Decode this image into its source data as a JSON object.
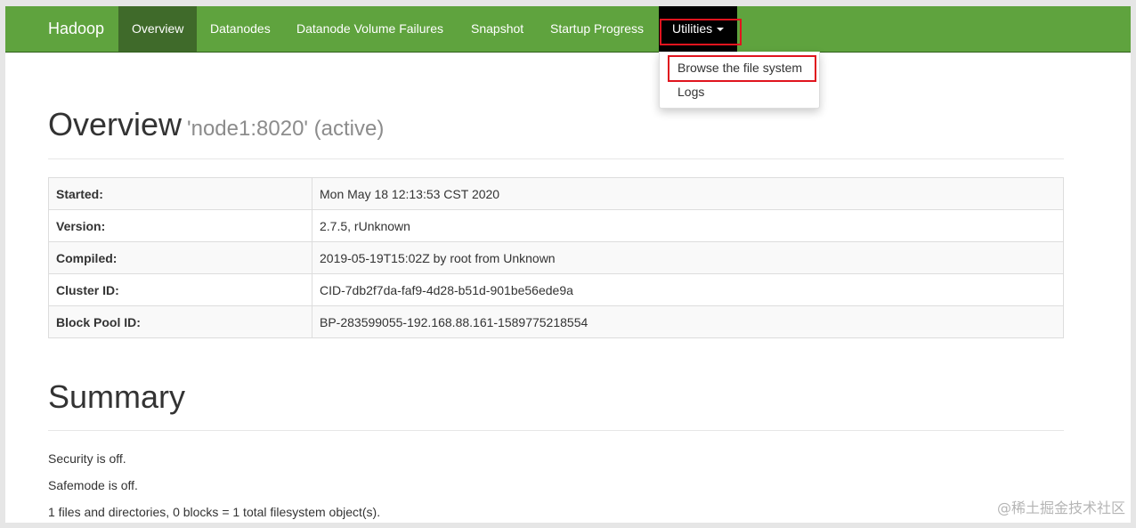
{
  "navbar": {
    "brand": "Hadoop",
    "items": [
      {
        "label": "Overview"
      },
      {
        "label": "Datanodes"
      },
      {
        "label": "Datanode Volume Failures"
      },
      {
        "label": "Snapshot"
      },
      {
        "label": "Startup Progress"
      },
      {
        "label": "Utilities"
      }
    ],
    "colors": {
      "bar": "#5fa33e",
      "active": "#3f6a2a",
      "open": "#000000",
      "highlight": "#e0141e"
    }
  },
  "dropdown": {
    "items": [
      {
        "label": "Browse the file system"
      },
      {
        "label": "Logs"
      }
    ]
  },
  "overview": {
    "title": "Overview",
    "subtitle": "'node1:8020' (active)",
    "rows": [
      {
        "key": "Started:",
        "value": "Mon May 18 12:13:53 CST 2020"
      },
      {
        "key": "Version:",
        "value": "2.7.5, rUnknown"
      },
      {
        "key": "Compiled:",
        "value": "2019-05-19T15:02Z by root from Unknown"
      },
      {
        "key": "Cluster ID:",
        "value": "CID-7db2f7da-faf9-4d28-b51d-901be56ede9a"
      },
      {
        "key": "Block Pool ID:",
        "value": "BP-283599055-192.168.88.161-1589775218554"
      }
    ]
  },
  "summary": {
    "title": "Summary",
    "lines": [
      "Security is off.",
      "Safemode is off.",
      "1 files and directories, 0 blocks = 1 total filesystem object(s)."
    ]
  },
  "watermark": "@稀土掘金技术社区"
}
